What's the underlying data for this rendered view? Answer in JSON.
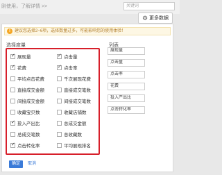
{
  "topbar": {
    "text": "刚使用，了解详情 >>",
    "search_placeholder": "关键词"
  },
  "more_button": {
    "label": "更多数据",
    "icon": "gear-icon"
  },
  "notice": {
    "text": "建议您选择2~6项，选择数量过多，可能影响您的使用体验！"
  },
  "section": {
    "left_title": "选择度量",
    "right_title": "列表"
  },
  "options": [
    {
      "label": "展现量",
      "checked": true
    },
    {
      "label": "点击量",
      "checked": true
    },
    {
      "label": "花费",
      "checked": true
    },
    {
      "label": "点击率",
      "checked": true
    },
    {
      "label": "平均点击花费",
      "checked": false
    },
    {
      "label": "千次展现花费",
      "checked": false
    },
    {
      "label": "直接成交金额",
      "checked": false
    },
    {
      "label": "直接成交笔数",
      "checked": false
    },
    {
      "label": "间接成交金额",
      "checked": false
    },
    {
      "label": "间接成交笔数",
      "checked": false
    },
    {
      "label": "收藏宝贝数",
      "checked": false
    },
    {
      "label": "收藏店铺数",
      "checked": false
    },
    {
      "label": "投入产出比",
      "checked": true
    },
    {
      "label": "总成交金额",
      "checked": false
    },
    {
      "label": "总成交笔数",
      "checked": false
    },
    {
      "label": "总收藏数",
      "checked": false
    },
    {
      "label": "点击转化率",
      "checked": true
    },
    {
      "label": "平均展现排名",
      "checked": false
    }
  ],
  "selected_list": [
    "展现量",
    "点击量",
    "点击率",
    "花费",
    "投入产出比",
    "点击转化率"
  ],
  "footer": {
    "ok": "确定",
    "cancel": "取消"
  }
}
